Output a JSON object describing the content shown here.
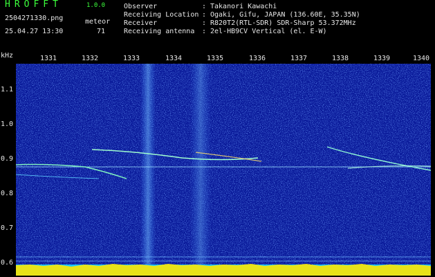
{
  "app": {
    "title": "HROFFT",
    "version": "1.0.0"
  },
  "file": {
    "name": "2504271330.png",
    "timestamp": "25.04.27 13:30"
  },
  "meteor": {
    "label": "meteor",
    "count": "71"
  },
  "metadata": [
    {
      "label": "Observer",
      "value": "Takanori Kawachi"
    },
    {
      "label": "Receiving Location",
      "value": "Ogaki, Gifu, JAPAN (136.60E, 35.35N)"
    },
    {
      "label": "Receiver",
      "value": "R820T2(RTL-SDR) SDR-Sharp 53.372MHz"
    },
    {
      "label": "Receiving antenna",
      "value": "2el-HB9CV Vertical (el. E-W)"
    }
  ],
  "separator": ":",
  "axis": {
    "unit": "kHz",
    "time_ticks": [
      "1331",
      "1332",
      "1333",
      "1334",
      "1335",
      "1336",
      "1337",
      "1338",
      "1339",
      "1340"
    ],
    "freq_ticks": [
      "1.1",
      "1.0",
      "0.9",
      "0.8",
      "0.7",
      "0.6"
    ]
  },
  "colors": {
    "background": "#000000",
    "spectrum_bg": "#0a1a9a",
    "header_green": "#3cff3c",
    "text_white": "#e8e8e8",
    "baseline_yellow": "#ffe600",
    "baseline_cyan": "#19c8ff"
  }
}
